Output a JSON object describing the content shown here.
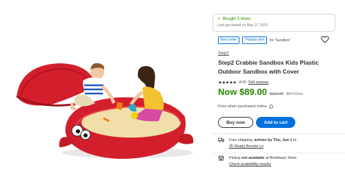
{
  "purchase_history": {
    "bought_label": "Bought 5 times",
    "last_purchased": "Last purchased on May 17, 2023"
  },
  "badges": {
    "best_seller": "Best seller",
    "popular_pick": "Popular pick",
    "context": "for \"Sandbox\""
  },
  "product": {
    "brand": "Step2",
    "title": "Step2 Crabbie Sandbox Kids Plastic Outdoor Sandbox with Cover",
    "stars": "★★★★★",
    "rating_value": 4.8,
    "rating_count": "(4.8)",
    "reviews_link": "544 reviews"
  },
  "price": {
    "now": "Now $89.00",
    "was": "$122.00",
    "unit": "$89.00/ea"
  },
  "note": {
    "text": "Price when purchased online",
    "icon": "info-icon"
  },
  "actions": {
    "buy_now": "Buy now",
    "add_to_cart": "Add to cart"
  },
  "shipping": {
    "prefix": "Free shipping, ",
    "arrives": "arrives by Thu, Jun 1",
    "suffix": " to",
    "address": "35 Shady Brooke Ln",
    "icon": "truck-icon"
  },
  "pickup": {
    "prefix": "Pickup ",
    "status": "not available",
    "suffix": " at Boothwyn Store",
    "check_link": "Check availability nearby",
    "icon": "store-icon"
  },
  "colors": {
    "green": "#2a8703",
    "blue": "#0071dc",
    "sandbox_red": "#d31f2c"
  }
}
